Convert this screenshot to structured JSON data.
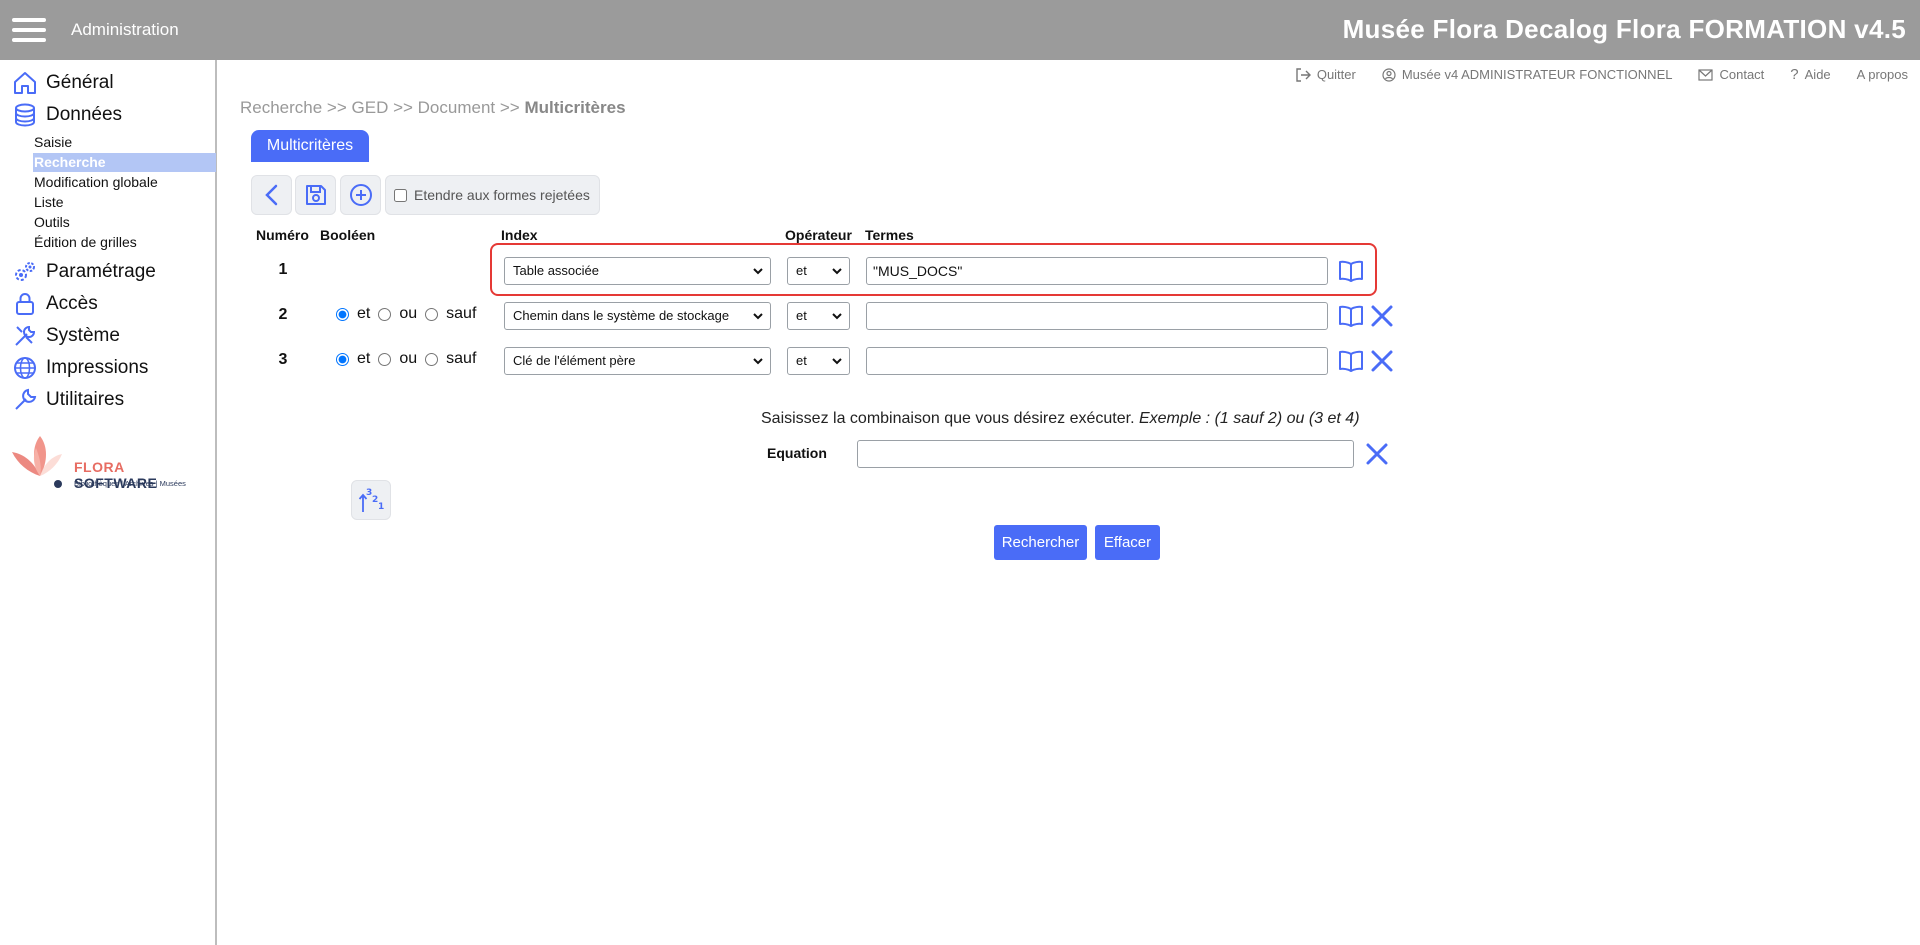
{
  "topbar": {
    "section": "Administration",
    "app_title": "Musée Flora Decalog Flora FORMATION v4.5"
  },
  "sidebar": {
    "main_items": [
      {
        "label": "Général",
        "icon": "home-icon"
      },
      {
        "label": "Données",
        "icon": "database-icon"
      },
      {
        "label": "Paramétrage",
        "icon": "gears-icon"
      },
      {
        "label": "Accès",
        "icon": "lock-icon"
      },
      {
        "label": "Système",
        "icon": "tools-icon"
      },
      {
        "label": "Impressions",
        "icon": "globe-icon"
      },
      {
        "label": "Utilitaires",
        "icon": "wrench-icon"
      }
    ],
    "sub_items": [
      "Saisie",
      "Recherche",
      "Modification globale",
      "Liste",
      "Outils",
      "Édition de grilles"
    ],
    "active_sub": "Recherche",
    "logo": {
      "brand_a": "FLORA",
      "brand_b": "SOFTWARE",
      "tagline": "Bibliothèques | Archives | Musées"
    }
  },
  "header_links": {
    "quit": "Quitter",
    "user": "Musée v4 ADMINISTRATEUR FONCTIONNEL",
    "contact": "Contact",
    "help": "Aide",
    "about": "A propos"
  },
  "breadcrumb": {
    "trail": "Recherche >> GED >> Document >> ",
    "current": "Multicritères"
  },
  "tab": "Multicritères",
  "toolbar": {
    "extend_label": "Etendre aux formes rejetées",
    "extend_checked": false
  },
  "columns": {
    "numero": "Numéro",
    "booleen": "Booléen",
    "index": "Index",
    "operateur": "Opérateur",
    "termes": "Termes"
  },
  "boolean_options": [
    "et",
    "ou",
    "sauf"
  ],
  "rows": [
    {
      "num": "1",
      "index": "Table associée",
      "operator": "et",
      "term": "\"MUS_DOCS\""
    },
    {
      "num": "2",
      "boolean": "et",
      "index": "Chemin dans le système de stockage",
      "operator": "et",
      "term": ""
    },
    {
      "num": "3",
      "boolean": "et",
      "index": "Clé de l'élément père",
      "operator": "et",
      "term": ""
    }
  ],
  "combination": {
    "instruction": "Saisissez la combinaison que vous désirez exécuter.",
    "example": "Exemple : (1 sauf 2) ou (3 et 4)",
    "equation_label": "Equation",
    "equation_value": ""
  },
  "buttons": {
    "search": "Rechercher",
    "clear": "Effacer"
  },
  "colors": {
    "topbar": "#9b9b9b",
    "accent": "#4a6cf7",
    "highlight": "#e53935",
    "active_nav": "#b3c6f5"
  }
}
